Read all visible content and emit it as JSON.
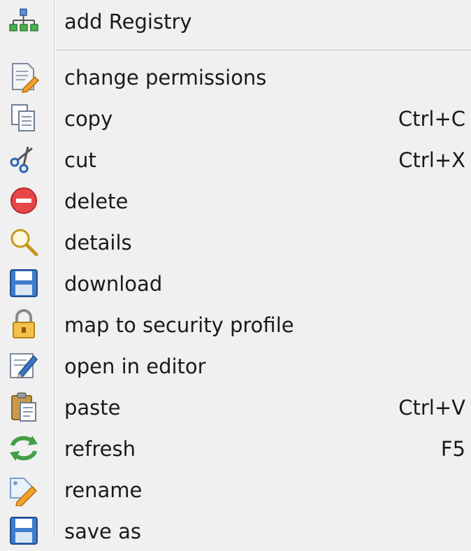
{
  "menu": {
    "items": [
      {
        "label": "add Registry",
        "shortcut": "",
        "icon": "registry-tree-icon"
      },
      {
        "label": "change permissions",
        "shortcut": "",
        "icon": "permissions-page-pen-icon"
      },
      {
        "label": "copy",
        "shortcut": "Ctrl+C",
        "icon": "copy-icon"
      },
      {
        "label": "cut",
        "shortcut": "Ctrl+X",
        "icon": "scissors-icon"
      },
      {
        "label": "delete",
        "shortcut": "",
        "icon": "delete-icon"
      },
      {
        "label": "details",
        "shortcut": "",
        "icon": "magnifier-icon"
      },
      {
        "label": "download",
        "shortcut": "",
        "icon": "floppy-disk-icon"
      },
      {
        "label": "map to security profile",
        "shortcut": "",
        "icon": "padlock-icon"
      },
      {
        "label": "open in editor",
        "shortcut": "",
        "icon": "edit-document-icon"
      },
      {
        "label": "paste",
        "shortcut": "Ctrl+V",
        "icon": "clipboard-icon"
      },
      {
        "label": "refresh",
        "shortcut": "F5",
        "icon": "refresh-arrows-icon"
      },
      {
        "label": "rename",
        "shortcut": "",
        "icon": "rename-tag-pencil-icon"
      },
      {
        "label": "save as",
        "shortcut": "",
        "icon": "floppy-disk-icon"
      }
    ]
  }
}
